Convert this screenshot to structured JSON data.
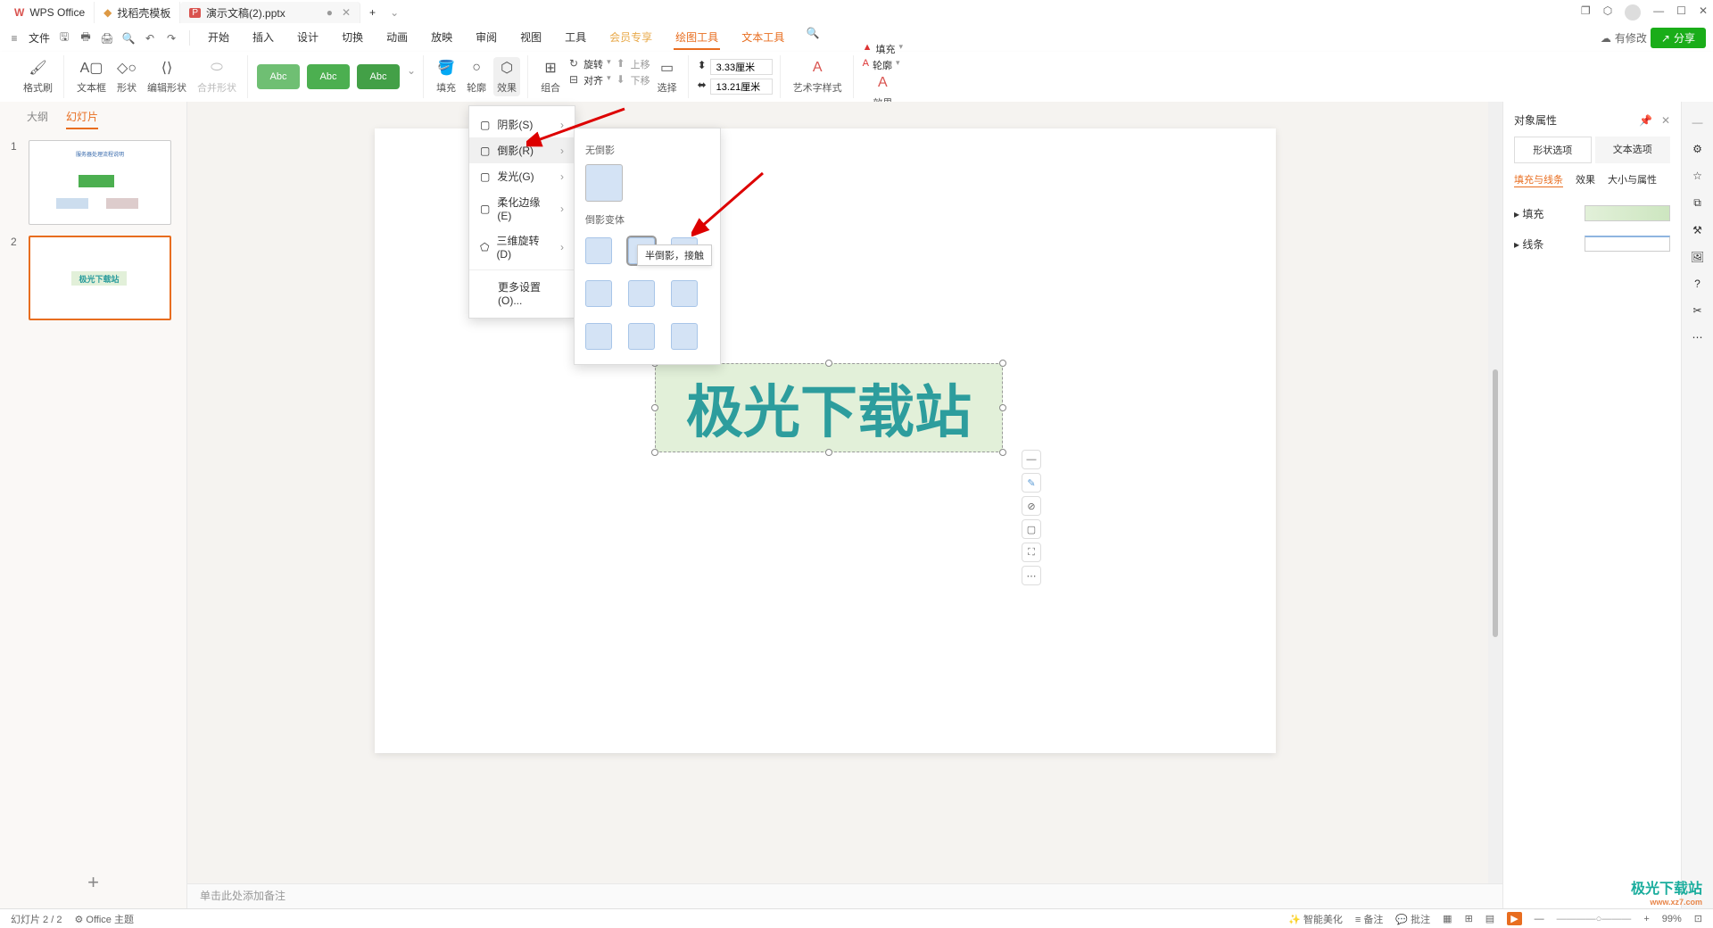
{
  "title_tabs": {
    "wps": "WPS Office",
    "templates": "找稻壳模板",
    "current": "演示文稿(2).pptx"
  },
  "menu": {
    "file": "文件",
    "tabs": [
      "开始",
      "插入",
      "设计",
      "切换",
      "动画",
      "放映",
      "审阅",
      "视图",
      "工具",
      "会员专享",
      "绘图工具",
      "文本工具"
    ],
    "has_changes": "有修改",
    "share": "分享"
  },
  "ribbon": {
    "format_painter": "格式刷",
    "textbox": "文本框",
    "shape": "形状",
    "edit_shape": "编辑形状",
    "merge_shape": "合并形状",
    "presets_label": "Abc",
    "fill": "填充",
    "outline": "轮廓",
    "effects": "效果",
    "group": "组合",
    "rotate": "旋转",
    "align": "对齐",
    "move_up": "上移",
    "move_down": "下移",
    "select": "选择",
    "height": "3.33厘米",
    "width": "13.21厘米",
    "wordart_style": "艺术字样式",
    "wa_fill": "填充",
    "wa_outline": "轮廓",
    "wa_effects": "效果"
  },
  "left_panel": {
    "outline": "大纲",
    "slides": "幻灯片",
    "thumbs": [
      "1",
      "2"
    ]
  },
  "canvas": {
    "wordart_text": "极光下载站",
    "notes_placeholder": "单击此处添加备注"
  },
  "effects_menu": {
    "shadow": "阴影(S)",
    "reflection": "倒影(R)",
    "glow": "发光(G)",
    "soft_edge": "柔化边缘(E)",
    "rotation_3d": "三维旋转(D)",
    "more": "更多设置(O)..."
  },
  "reflection_panel": {
    "none": "无倒影",
    "variants": "倒影变体",
    "tooltip": "半倒影，接触"
  },
  "right_panel": {
    "title": "对象属性",
    "shape_options": "形状选项",
    "text_options": "文本选项",
    "fill_line": "填充与线条",
    "effect": "效果",
    "size_prop": "大小与属性",
    "fill": "填充",
    "line": "线条"
  },
  "status": {
    "slide_count": "幻灯片 2 / 2",
    "theme": "Office 主题",
    "beautify": "智能美化",
    "notes": "备注",
    "comments": "批注",
    "zoom": "99%"
  },
  "watermark": {
    "text": "极光下载站",
    "url": "www.xz7.com"
  }
}
